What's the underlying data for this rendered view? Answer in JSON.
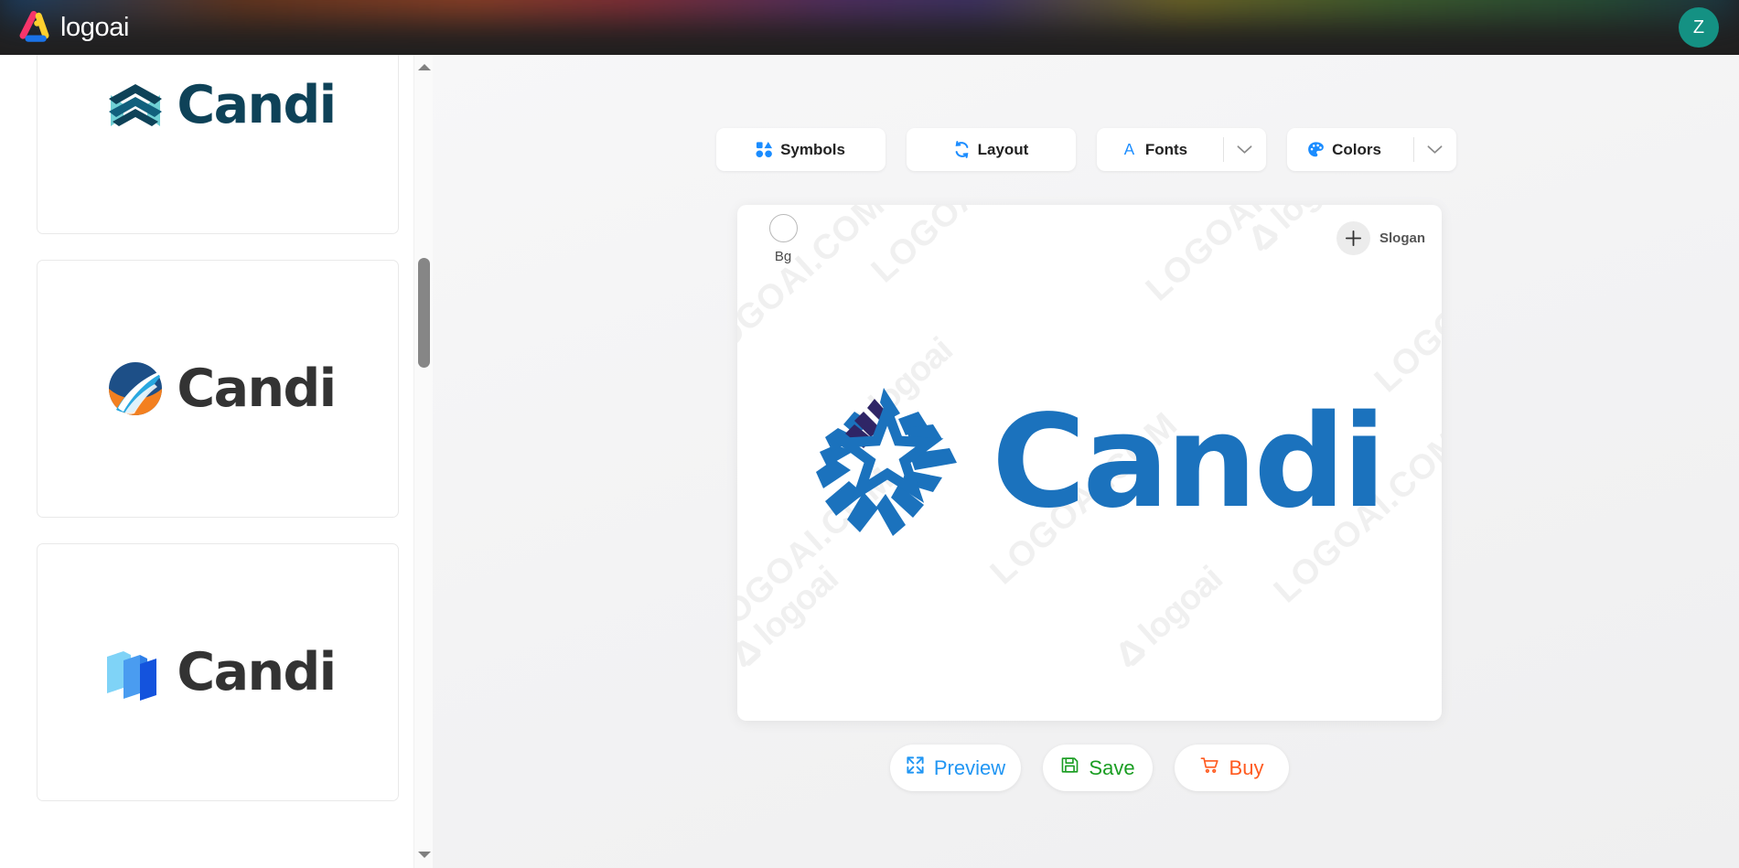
{
  "topbar": {
    "brand_name": "logoai",
    "brand_icon": "logoai-triangle-icon",
    "avatar_initial": "Z",
    "avatar_color": "#149183",
    "background": "#201f1f"
  },
  "sidebar": {
    "scrollbar": {
      "up_icon": "scroll-up-arrow-icon",
      "down_icon": "scroll-down-arrow-icon"
    },
    "thumbnails": [
      {
        "name": "Candi",
        "symbol_icon": "double-chevron-icon",
        "text_color": "#0e4258",
        "symbol_colors": [
          "#6fcfd4",
          "#0e4258",
          "#11607d"
        ]
      },
      {
        "name": "Candi",
        "symbol_icon": "globe-swoosh-icon",
        "text_color": "#333333",
        "symbol_colors": [
          "#1d4f87",
          "#29a8e0",
          "#f38020"
        ]
      },
      {
        "name": "Candi",
        "symbol_icon": "isometric-cube-icon",
        "text_color": "#333333",
        "symbol_colors": [
          "#7fd3f7",
          "#4a9cf0",
          "#1453dd"
        ]
      }
    ]
  },
  "toolbar": {
    "buttons": [
      {
        "label": "Symbols",
        "icon": "symbols-shapes-icon",
        "has_caret": false,
        "icon_color": "#1a8cff"
      },
      {
        "label": "Layout",
        "icon": "layout-refresh-icon",
        "has_caret": false,
        "icon_color": "#1a8cff"
      },
      {
        "label": "Fonts",
        "icon": "font-letter-a-icon",
        "has_caret": true,
        "icon_color": "#1a8cff"
      },
      {
        "label": "Colors",
        "icon": "color-palette-icon",
        "has_caret": true,
        "icon_color": "#1a8cff"
      }
    ],
    "caret_icon": "chevron-down-icon"
  },
  "canvas": {
    "bg_control": {
      "label": "Bg",
      "icon": "background-color-swatch-icon"
    },
    "slogan_control": {
      "label": "Slogan",
      "icon": "plus-icon"
    },
    "logo": {
      "name": "Candi",
      "text_color": "#1b72bd",
      "symbol_icon": "star-burst-icon",
      "symbol_colors": [
        "#1b72bd",
        "#2f2566",
        "#1a6bb5"
      ]
    },
    "watermarks": [
      "LOGOAI.COM",
      "logoai",
      "LOGOAI.COM",
      "logoai",
      "LOGOAI.COM",
      "logoai",
      "LOGOAI.COM",
      "logoai"
    ]
  },
  "actions": [
    {
      "label": "Preview",
      "icon": "expand-fullscreen-icon",
      "color": "#2196f3"
    },
    {
      "label": "Save",
      "icon": "floppy-disk-icon",
      "color": "#1a9d22"
    },
    {
      "label": "Buy",
      "icon": "shopping-cart-icon",
      "color": "#ff5a1f"
    }
  ]
}
